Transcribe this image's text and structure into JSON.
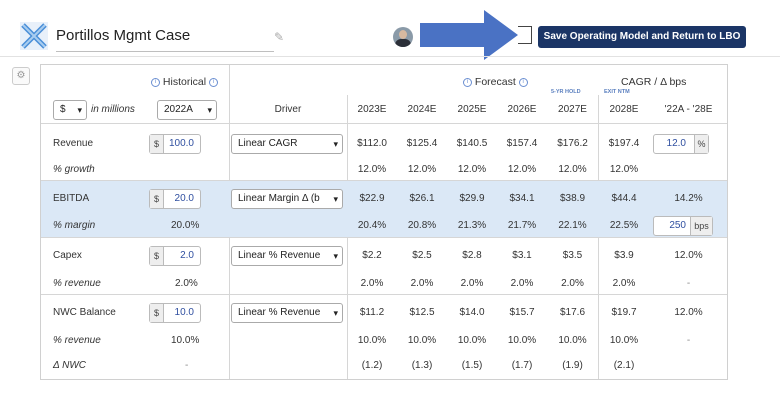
{
  "header": {
    "title": "Portillos Mgmt Case",
    "save_button": "Save Operating Model and Return to LBO"
  },
  "table": {
    "historical_label": "Historical",
    "forecast_label": "Forecast",
    "cagr_label": "CAGR / Δ bps",
    "currency": "$",
    "units": "in millions",
    "year": "2022A",
    "driver_header": "Driver",
    "cagr_range": "'22A - '28E",
    "years": [
      "2023E",
      "2024E",
      "2025E",
      "2026E",
      "2027E",
      "2028E"
    ],
    "tag_5yr": "5-YR HOLD",
    "tag_exit": "EXIT NTM",
    "rows": {
      "revenue": {
        "label": "Revenue",
        "hist_symbol": "$",
        "hist_value": "100.0",
        "driver": "Linear CAGR",
        "values": [
          "$112.0",
          "$125.4",
          "$140.5",
          "$157.4",
          "$176.2",
          "$197.4"
        ],
        "cagr_input": "12.0",
        "cagr_unit": "%"
      },
      "growth": {
        "label": "% growth",
        "values": [
          "12.0%",
          "12.0%",
          "12.0%",
          "12.0%",
          "12.0%",
          "12.0%"
        ]
      },
      "ebitda": {
        "label": "EBITDA",
        "hist_symbol": "$",
        "hist_value": "20.0",
        "driver": "Linear Margin Δ (b",
        "values": [
          "$22.9",
          "$26.1",
          "$29.9",
          "$34.1",
          "$38.9",
          "$44.4"
        ],
        "cagr": "14.2%"
      },
      "margin": {
        "label": "% margin",
        "hist": "20.0%",
        "values": [
          "20.4%",
          "20.8%",
          "21.3%",
          "21.7%",
          "22.1%",
          "22.5%"
        ],
        "bps_input": "250",
        "bps_unit": "bps"
      },
      "capex": {
        "label": "Capex",
        "hist_symbol": "$",
        "hist_value": "2.0",
        "driver": "Linear % Revenue",
        "values": [
          "$2.2",
          "$2.5",
          "$2.8",
          "$3.1",
          "$3.5",
          "$3.9"
        ],
        "cagr": "12.0%"
      },
      "capex_rev": {
        "label": "% revenue",
        "hist": "2.0%",
        "values": [
          "2.0%",
          "2.0%",
          "2.0%",
          "2.0%",
          "2.0%",
          "2.0%"
        ],
        "cagr": "-"
      },
      "nwc": {
        "label": "NWC Balance",
        "hist_symbol": "$",
        "hist_value": "10.0",
        "driver": "Linear % Revenue",
        "values": [
          "$11.2",
          "$12.5",
          "$14.0",
          "$15.7",
          "$17.6",
          "$19.7"
        ],
        "cagr": "12.0%"
      },
      "nwc_rev": {
        "label": "% revenue",
        "hist": "10.0%",
        "values": [
          "10.0%",
          "10.0%",
          "10.0%",
          "10.0%",
          "10.0%",
          "10.0%"
        ],
        "cagr": "-"
      },
      "dnwc": {
        "label": "Δ NWC",
        "hist": "-",
        "values": [
          "(1.2)",
          "(1.3)",
          "(1.5)",
          "(1.7)",
          "(1.9)",
          "(2.1)"
        ]
      }
    }
  },
  "colors": {
    "accent": "#1b3566",
    "highlight": "#dbe8f6",
    "arrow": "#4a72c4"
  }
}
